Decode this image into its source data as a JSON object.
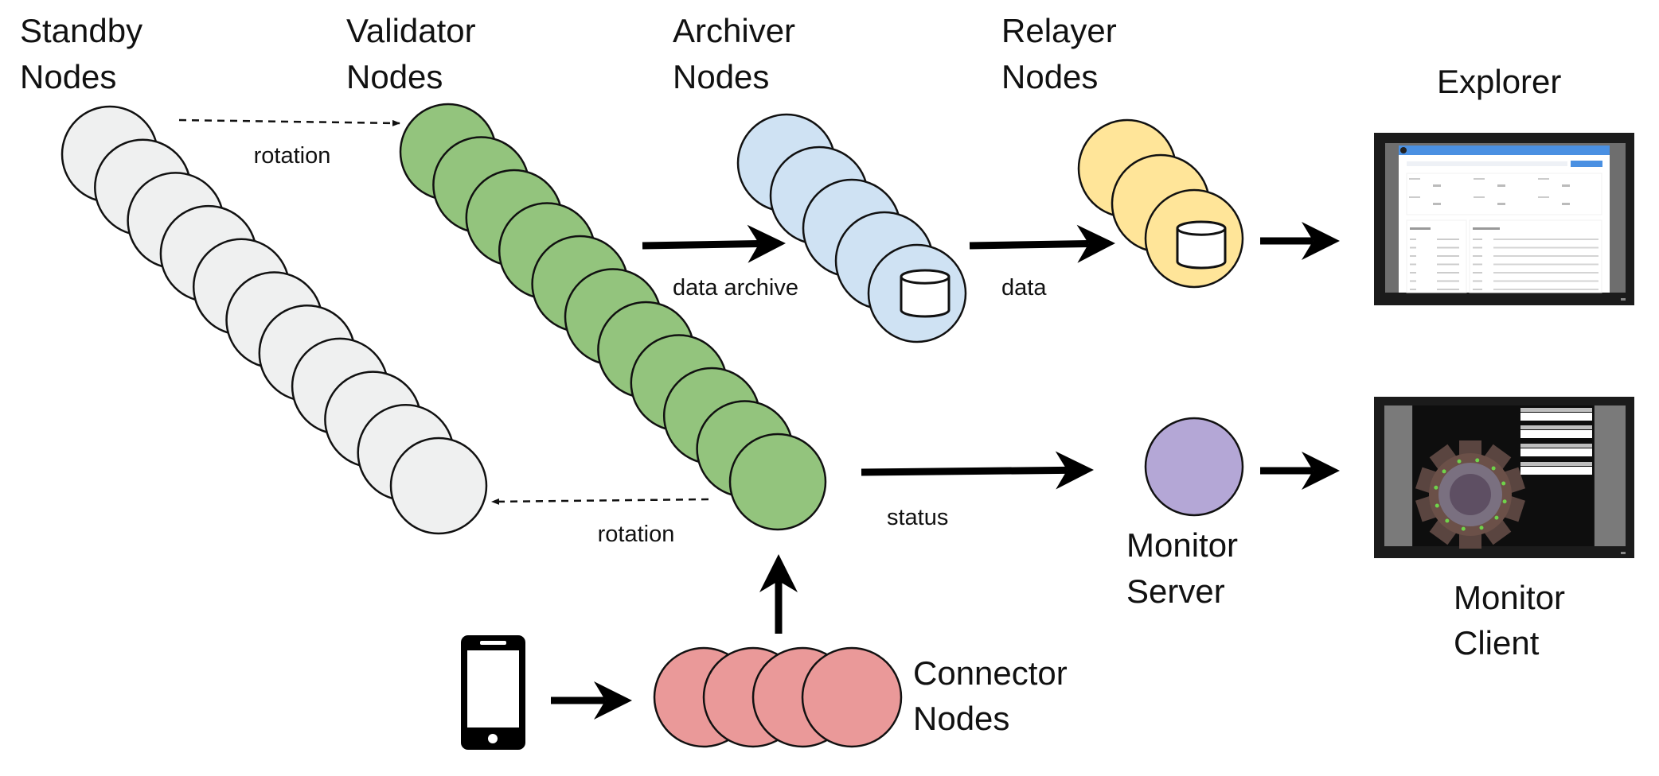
{
  "titles": {
    "standby": [
      "Standby",
      "Nodes"
    ],
    "validator": [
      "Validator",
      "Nodes"
    ],
    "archiver": [
      "Archiver",
      "Nodes"
    ],
    "relayer": [
      "Relayer",
      "Nodes"
    ],
    "explorer": [
      "Explorer"
    ],
    "monitor_server": [
      "Monitor",
      "Server"
    ],
    "monitor_client": [
      "Monitor",
      "Client"
    ],
    "connector": [
      "Connector",
      "Nodes"
    ]
  },
  "edge_labels": {
    "rotation_top": "rotation",
    "rotation_bottom": "rotation",
    "data_archive": "data archive",
    "data": "data",
    "status": "status"
  },
  "node_groups": {
    "standby": {
      "count": 11,
      "color": "#eff0f0"
    },
    "validator": {
      "count": 11,
      "color": "#93c47d"
    },
    "archiver": {
      "count": 5,
      "color": "#cfe2f3",
      "icon": "database-icon"
    },
    "relayer": {
      "count": 3,
      "color": "#ffe599",
      "icon": "database-icon"
    },
    "monitor_server": {
      "count": 1,
      "color": "#b4a7d6"
    },
    "connector": {
      "count": 4,
      "color": "#ea9999"
    }
  },
  "client_icon": "smartphone-icon",
  "colors": {
    "stroke": "#111111",
    "explorer_header": "#4a90e2",
    "monitor_dot": "#6fd34a"
  }
}
